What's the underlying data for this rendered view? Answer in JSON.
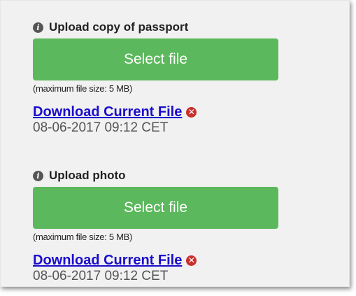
{
  "passport": {
    "label": "Upload copy of passport",
    "button_label": "Select file",
    "hint": "(maximum file size: 5 MB)",
    "download_label": "Download Current File",
    "timestamp": "08-06-2017 09:12 CET",
    "info_icon": "info-icon",
    "remove_icon": "remove-icon"
  },
  "photo": {
    "label": "Upload photo",
    "button_label": "Select file",
    "hint": "(maximum file size: 5 MB)",
    "download_label": "Download Current File",
    "timestamp": "08-06-2017 09:12 CET",
    "info_icon": "info-icon",
    "remove_icon": "remove-icon"
  },
  "colors": {
    "button": "#5cb85c",
    "link": "#1a0dcc",
    "remove": "#c9302c",
    "panel": "#f1f1f1"
  }
}
